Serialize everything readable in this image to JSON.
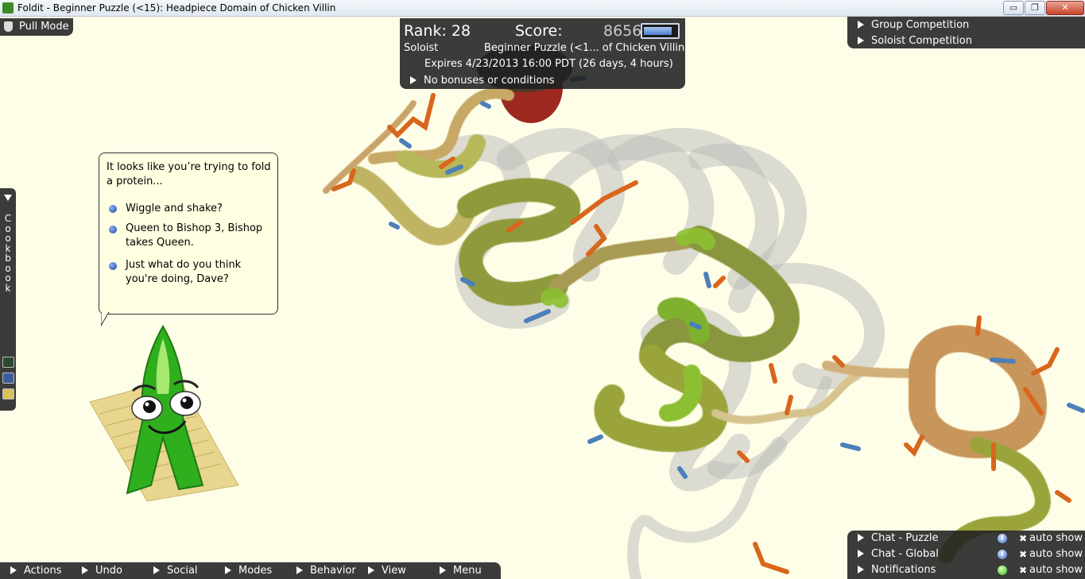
{
  "window": {
    "title": "Foldit - Beginner Puzzle (<15): Headpiece Domain of Chicken Villin",
    "minimize_glyph": "▭",
    "maximize_glyph": "❐",
    "close_glyph": "✕"
  },
  "pull_mode": {
    "label": "Pull Mode",
    "icon": "hand-icon"
  },
  "score_panel": {
    "rank": "Rank: 28",
    "score_label": "Score:",
    "score_value": "8656",
    "score_progress": 0.85,
    "role": "Soloist",
    "puzzle_name": "Beginner Puzzle (<1... of Chicken Villin",
    "expires": "Expires 4/23/2013 16:00 PDT (26 days, 4 hours)",
    "bonuses": "No bonuses or conditions"
  },
  "competitions": {
    "group": "Group Competition",
    "soloist": "Soloist Competition"
  },
  "cookbook": {
    "label": "Cookbook"
  },
  "tip": {
    "text": "It looks like you’re trying to fold a protein...",
    "choices": [
      "Wiggle and shake?",
      "Queen to Bishop 3, Bishop takes Queen.",
      "Just what do you think you're doing, Dave?"
    ]
  },
  "bottom_menu": {
    "items": [
      "Actions",
      "Undo",
      "Social",
      "Modes",
      "Behavior",
      "View",
      "Menu"
    ]
  },
  "chat_panel": {
    "rows": [
      {
        "label": "Chat - Puzzle",
        "icon": "info-icon",
        "toggle": "auto show"
      },
      {
        "label": "Chat - Global",
        "icon": "info-icon",
        "toggle": "auto show"
      },
      {
        "label": "Notifications",
        "icon": "green-status-icon",
        "toggle": "auto show"
      }
    ]
  },
  "colors": {
    "background": "#fefee8",
    "panel": "#202020",
    "backbone_green": "#9aa43a",
    "backbone_orange": "#c8955a",
    "sidechain_orange": "#d8661c",
    "sidechain_blue": "#4d7fb8",
    "ghost_gray": "#bdbdbd",
    "mascot_green": "#2fae1e"
  }
}
